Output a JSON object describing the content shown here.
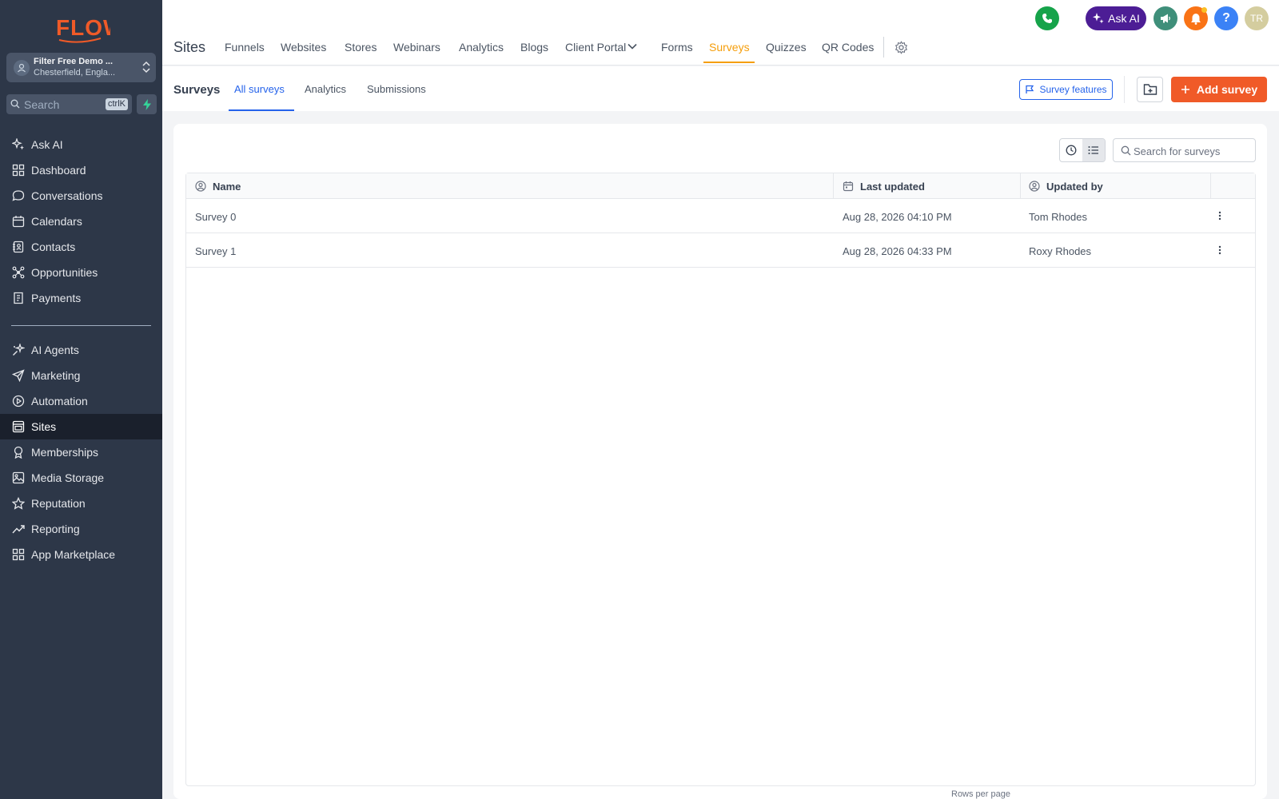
{
  "brand": {
    "logo_text": "FLOW",
    "accent": "#f05a28"
  },
  "account": {
    "name": "Filter Free Demo ...",
    "location": "Chesterfield, Engla..."
  },
  "sidebar_search": {
    "placeholder": "Search",
    "shortcut": "ctrlK"
  },
  "sidebar": {
    "items": [
      {
        "label": "Ask AI",
        "icon": "sparkles-icon"
      },
      {
        "label": "Dashboard",
        "icon": "grid-icon"
      },
      {
        "label": "Conversations",
        "icon": "chat-icon"
      },
      {
        "label": "Calendars",
        "icon": "calendar-icon"
      },
      {
        "label": "Contacts",
        "icon": "contacts-icon"
      },
      {
        "label": "Opportunities",
        "icon": "opportunities-icon"
      },
      {
        "label": "Payments",
        "icon": "receipt-icon"
      }
    ],
    "items2": [
      {
        "label": "AI Agents",
        "icon": "ai-agents-icon"
      },
      {
        "label": "Marketing",
        "icon": "send-icon"
      },
      {
        "label": "Automation",
        "icon": "automation-icon"
      },
      {
        "label": "Sites",
        "icon": "sites-icon",
        "active": true
      },
      {
        "label": "Memberships",
        "icon": "award-icon"
      },
      {
        "label": "Media Storage",
        "icon": "image-icon"
      },
      {
        "label": "Reputation",
        "icon": "star-icon"
      },
      {
        "label": "Reporting",
        "icon": "trending-icon"
      },
      {
        "label": "App Marketplace",
        "icon": "apps-icon"
      }
    ]
  },
  "header": {
    "title": "Sites",
    "tabs": [
      "Funnels",
      "Websites",
      "Stores",
      "Webinars",
      "Analytics",
      "Blogs",
      "Client Portal",
      "Forms",
      "Surveys",
      "Quizzes",
      "QR Codes"
    ],
    "active_tab": "Surveys",
    "ask_ai_label": "Ask AI",
    "user_initials": "TR"
  },
  "subnav": {
    "title": "Surveys",
    "tabs": [
      "All surveys",
      "Analytics",
      "Submissions"
    ],
    "active_tab": "All surveys",
    "features_label": "Survey features",
    "add_label": "Add survey"
  },
  "table": {
    "search_placeholder": "Search for surveys",
    "columns": [
      "Name",
      "Last updated",
      "Updated by"
    ],
    "rows": [
      {
        "name": "Survey 0",
        "last_updated": "Aug 28, 2026 04:10 PM",
        "updated_by": "Tom Rhodes"
      },
      {
        "name": "Survey 1",
        "last_updated": "Aug 28, 2026 04:33 PM",
        "updated_by": "Roxy Rhodes"
      }
    ]
  },
  "pagination": {
    "label": "Rows per page"
  }
}
